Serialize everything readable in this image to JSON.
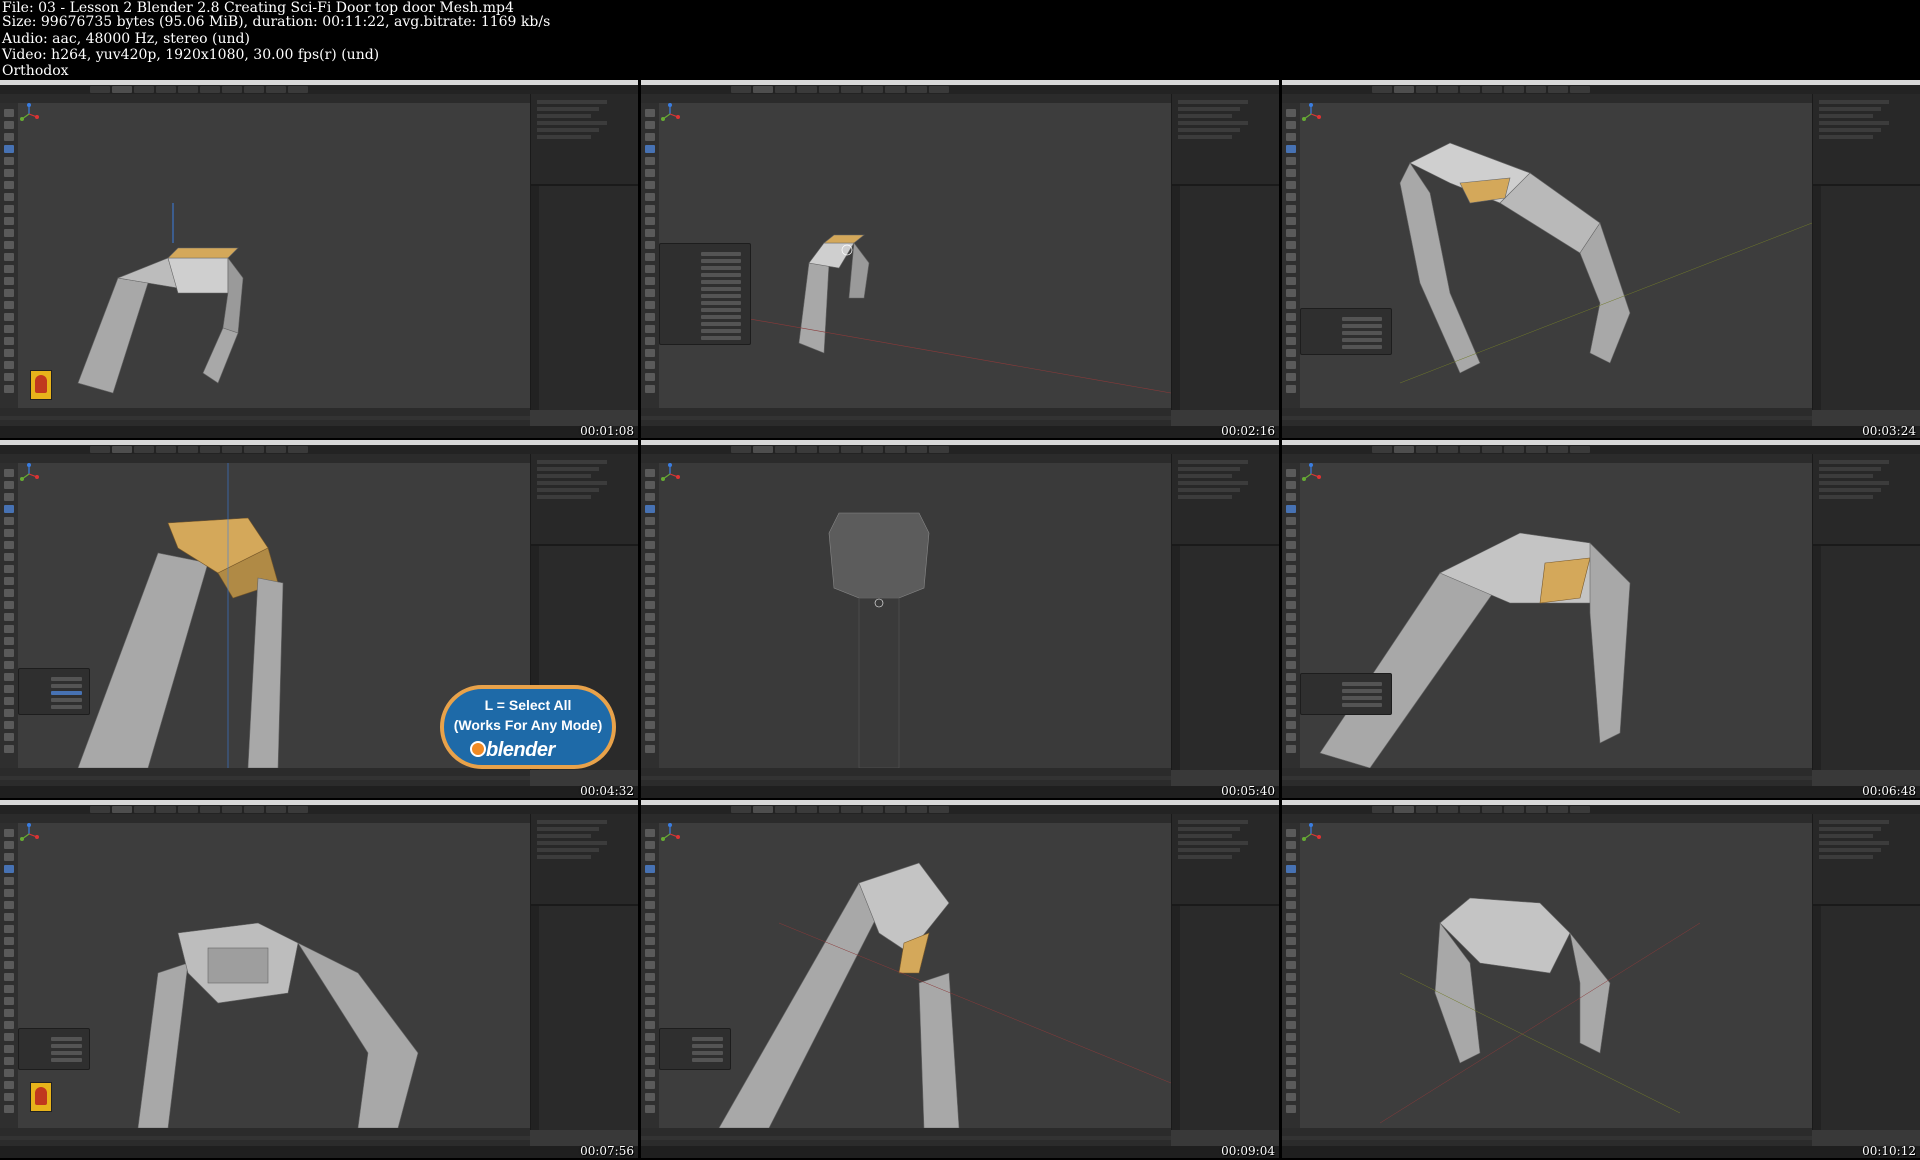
{
  "header": {
    "file_line": "File: 03 - Lesson 2 Blender 2.8 Creating Sci-Fi Door top door Mesh.mp4",
    "size_line": "Size: 99676735 bytes (95.06 MiB), duration: 00:11:22, avg.bitrate: 1169 kb/s",
    "audio_line": "Audio: aac, 48000 Hz, stereo (und)",
    "video_line": "Video: h264, yuv420p, 1920x1080, 30.00 fps(r) (und)",
    "font_line": "Orthodox"
  },
  "thumbnails": [
    {
      "timestamp": "00:01:08"
    },
    {
      "timestamp": "00:02:16"
    },
    {
      "timestamp": "00:03:24"
    },
    {
      "timestamp": "00:04:32"
    },
    {
      "timestamp": "00:05:40"
    },
    {
      "timestamp": "00:06:48"
    },
    {
      "timestamp": "00:07:56"
    },
    {
      "timestamp": "00:09:04"
    },
    {
      "timestamp": "00:10:12"
    }
  ],
  "overlay": {
    "line1": "L = Select All",
    "line2": "(Works For Any Mode)",
    "brand": "blender"
  },
  "colors": {
    "viewport": "#3d3d3d",
    "mesh": "#a8a8a8",
    "selected_face": "#d4a85a",
    "overlay_fill": "#1e6aa8",
    "overlay_border": "#e8a24a"
  }
}
